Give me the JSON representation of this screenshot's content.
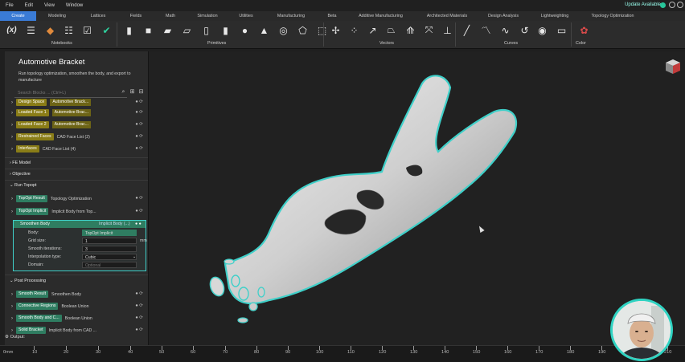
{
  "menu": [
    "File",
    "Edit",
    "View",
    "Window"
  ],
  "update": "Update Available",
  "tabs": [
    "Create",
    "Modeling",
    "Lattices",
    "Fields",
    "Math",
    "Simulation",
    "Utilities",
    "Manufacturing",
    "Beta",
    "Additive Manufacturing",
    "Architected Materials",
    "Design Analysis",
    "Lightweighting",
    "Topology Optimization"
  ],
  "toolbar_groups": [
    "Notebooks",
    "Primitives",
    "Vectors",
    "Curves",
    "Color"
  ],
  "panel": {
    "title": "Automotive Bracket",
    "description": "Run topology optimization, smoothen the body, and export to manufacture",
    "search_placeholder": "Search Blocks ... (Ctrl+L)",
    "rows_top": [
      {
        "label": "Design Space",
        "value": "Automotive Brack..."
      },
      {
        "label": "Loaded Face 1",
        "value": "Automotive Brac..."
      },
      {
        "label": "Loaded Face 2",
        "value": "Automotive Brac..."
      },
      {
        "label": "Restrained Faces",
        "value": "CAD Face List (2)"
      },
      {
        "label": "Interfaces",
        "value": "CAD Face List (4)"
      }
    ],
    "sections": [
      "FE Model",
      "Objective",
      "Run Topopt",
      "Post Processing"
    ],
    "run_rows": [
      {
        "label": "TopOpt Result",
        "value": "Topology Optimization"
      },
      {
        "label": "TopOpt Implicit",
        "value": "Implicit Body from Top..."
      }
    ],
    "card": {
      "title": "Smoothen Body",
      "type": "Implicit Body (...)",
      "props": [
        {
          "name": "Body:",
          "value": "TopOpt Implicit"
        },
        {
          "name": "Grid size:",
          "value": "1"
        },
        {
          "name": "Smooth iterations:",
          "value": "3"
        },
        {
          "name": "Interpolation type:",
          "value": "Cubic"
        },
        {
          "name": "Domain:",
          "value": "Optional"
        }
      ],
      "unit": "mm"
    },
    "post_rows": [
      {
        "label": "Smooth Result",
        "value": "Smoothen Body"
      },
      {
        "label": "Connective Regions",
        "value": "Boolean Union"
      },
      {
        "label": "Smooth Body and C...",
        "value": "Boolean Union"
      },
      {
        "label": "Solid Bracket",
        "value": "Implicit Body from CAD ..."
      }
    ],
    "output": "Output:"
  },
  "ruler": {
    "unit": "mm",
    "ticks": [
      "0",
      "10",
      "20",
      "30",
      "40",
      "50",
      "60",
      "70",
      "80",
      "90",
      "100",
      "110",
      "120",
      "130",
      "140",
      "150",
      "160",
      "170",
      "180",
      "190",
      "210"
    ]
  },
  "colors": {
    "accent": "#3a7bd5",
    "outline": "#3fd0c9",
    "yellow_block": "#8a7d17",
    "green_block": "#2f7d61"
  }
}
